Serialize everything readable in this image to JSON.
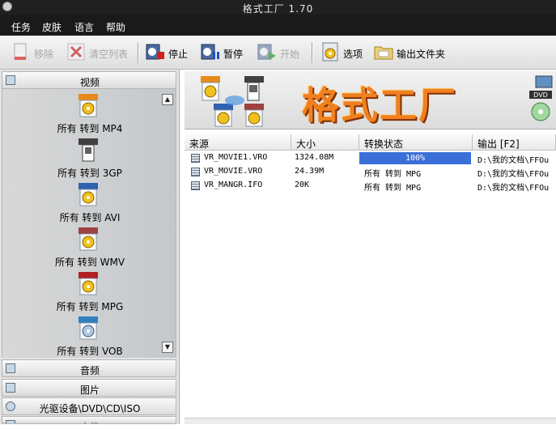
{
  "window": {
    "title": "格式工厂  1.70"
  },
  "menu": [
    "任务",
    "皮肤",
    "语言",
    "帮助"
  ],
  "toolbar": {
    "remove": "移除",
    "clear_list": "清空列表",
    "stop": "停止",
    "pause": "暂停",
    "start": "开始",
    "options": "选项",
    "output_folder": "输出文件夹"
  },
  "sidebar": {
    "categories": {
      "video": "视频",
      "audio": "音频",
      "image": "图片",
      "rom": "光驱设备\\DVD\\CD\\ISO",
      "advanced": "高级"
    },
    "formats": [
      {
        "badge": "MP4",
        "label": "所有 转到 MP4",
        "color": "#e88a1a"
      },
      {
        "badge": "3GP",
        "label": "所有 转到 3GP",
        "color": "#404040"
      },
      {
        "badge": "AVI",
        "label": "所有 转到 AVI",
        "color": "#3060b0"
      },
      {
        "badge": "WMV",
        "label": "所有 转到 WMV",
        "color": "#a04040"
      },
      {
        "badge": "MPG",
        "label": "所有 转到 MPG",
        "color": "#b02020"
      },
      {
        "badge": "VOB",
        "label": "所有 转到 VOB",
        "color": "#3080c0"
      }
    ]
  },
  "banner": {
    "logo": "格式工厂",
    "badges": [
      "MP4",
      "3GP",
      "AVI",
      "WMV"
    ],
    "dvd_label": "DVD"
  },
  "table": {
    "columns": [
      "来源",
      "大小",
      "转换状态",
      "输出 [F2]"
    ],
    "rows": [
      {
        "source": "VR_MOVIE1.VRO",
        "size": "1324.08M",
        "status": "100%",
        "progress": 1.0,
        "output": "D:\\我的文档\\FFOu"
      },
      {
        "source": "VR_MOVIE.VRO",
        "size": "24.39M",
        "status": "所有 转到 MPG",
        "progress": null,
        "output": "D:\\我的文档\\FFOu"
      },
      {
        "source": "VR_MANGR.IFO",
        "size": "20K",
        "status": "所有 转到 MPG",
        "progress": null,
        "output": "D:\\我的文档\\FFOu"
      }
    ]
  },
  "icons": {
    "remove": "document-remove-icon",
    "clear": "red-x-icon",
    "stop": "film-stop-icon",
    "pause": "film-pause-icon",
    "start": "film-play-icon",
    "options": "gear-options-icon",
    "folder": "folder-icon"
  }
}
